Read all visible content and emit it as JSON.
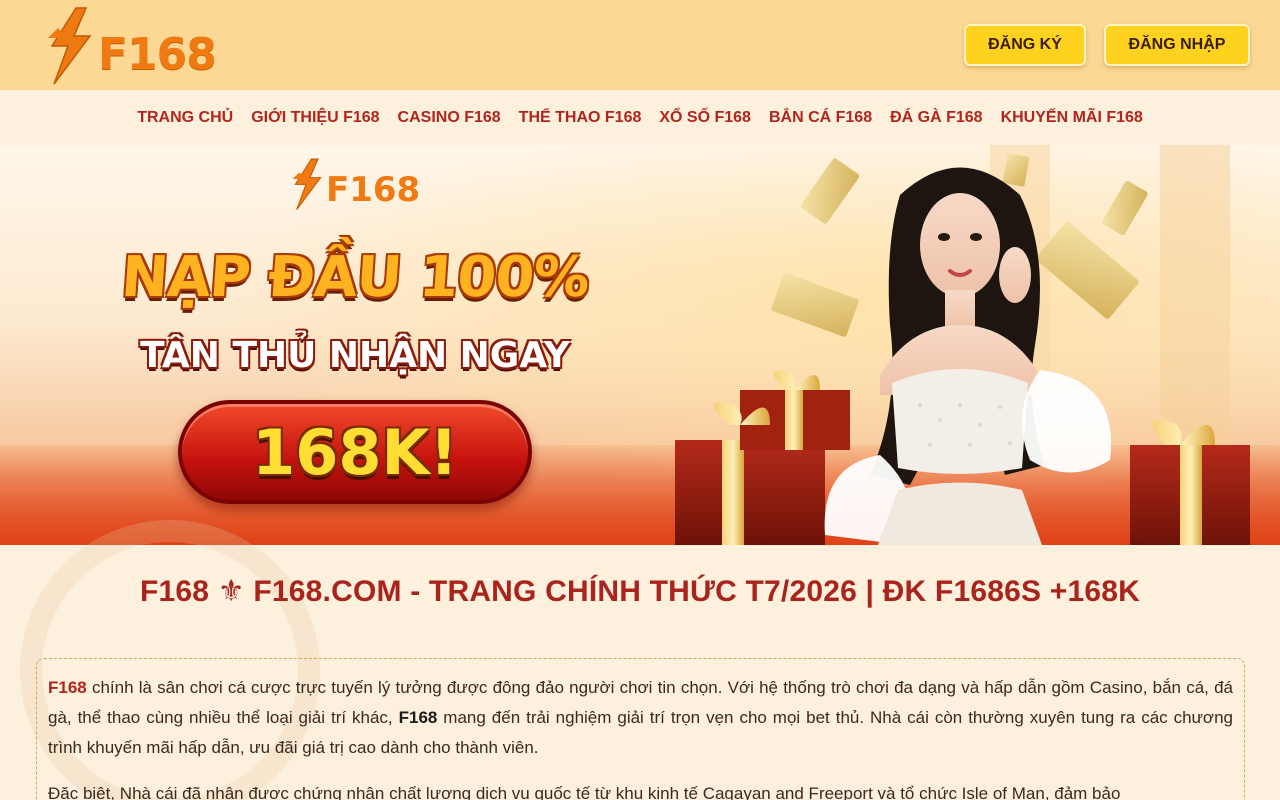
{
  "header": {
    "logo_text": "F168",
    "register_label": "ĐĂNG KÝ",
    "login_label": "ĐĂNG NHẬP"
  },
  "nav": {
    "items": [
      {
        "label": "TRANG CHỦ"
      },
      {
        "label": "GIỚI THIỆU F168"
      },
      {
        "label": "CASINO F168"
      },
      {
        "label": "THỂ THAO F168"
      },
      {
        "label": "XỔ SỐ F168"
      },
      {
        "label": "BẮN CÁ F168"
      },
      {
        "label": "ĐÁ GÀ F168"
      },
      {
        "label": "KHUYẾN MÃI F168"
      }
    ]
  },
  "banner": {
    "logo_text": "F168",
    "headline": "NẠP ĐẦU 100%",
    "subheadline": "TÂN THỦ NHẬN NGAY",
    "amount": "168K!"
  },
  "main": {
    "title": "F168 ⚜ F168.COM - TRANG CHÍNH THỨC T7/2026 | ĐK F1686S +168K",
    "intro": {
      "p1_brand": "F168",
      "p1_part1": " chính là sân chơi cá cược trực tuyến lý tưởng được đông đảo người chơi tin chọn. Với hệ thống trò chơi đa dạng và hấp dẫn gồm Casino, bắn cá, đá gà, thể thao cùng nhiều thể loại giải trí khác, ",
      "p1_brand2": "F168",
      "p1_part2": " mang đến trải nghiệm giải trí trọn vẹn cho mọi bet thủ. Nhà cái còn thường xuyên tung ra các chương trình khuyến mãi hấp dẫn, ưu đãi giá trị cao dành cho thành viên.",
      "p2": "Đặc biệt, Nhà cái đã nhận được chứng nhận chất lượng dịch vụ quốc tế từ khu kinh tế Cagayan and Freeport và tổ chức Isle of Man, đảm bảo"
    }
  },
  "colors": {
    "header_bg": "#fbd995",
    "accent_red": "#b0261e",
    "button_yellow": "#ffd21f",
    "logo_orange": "#f07a12"
  }
}
